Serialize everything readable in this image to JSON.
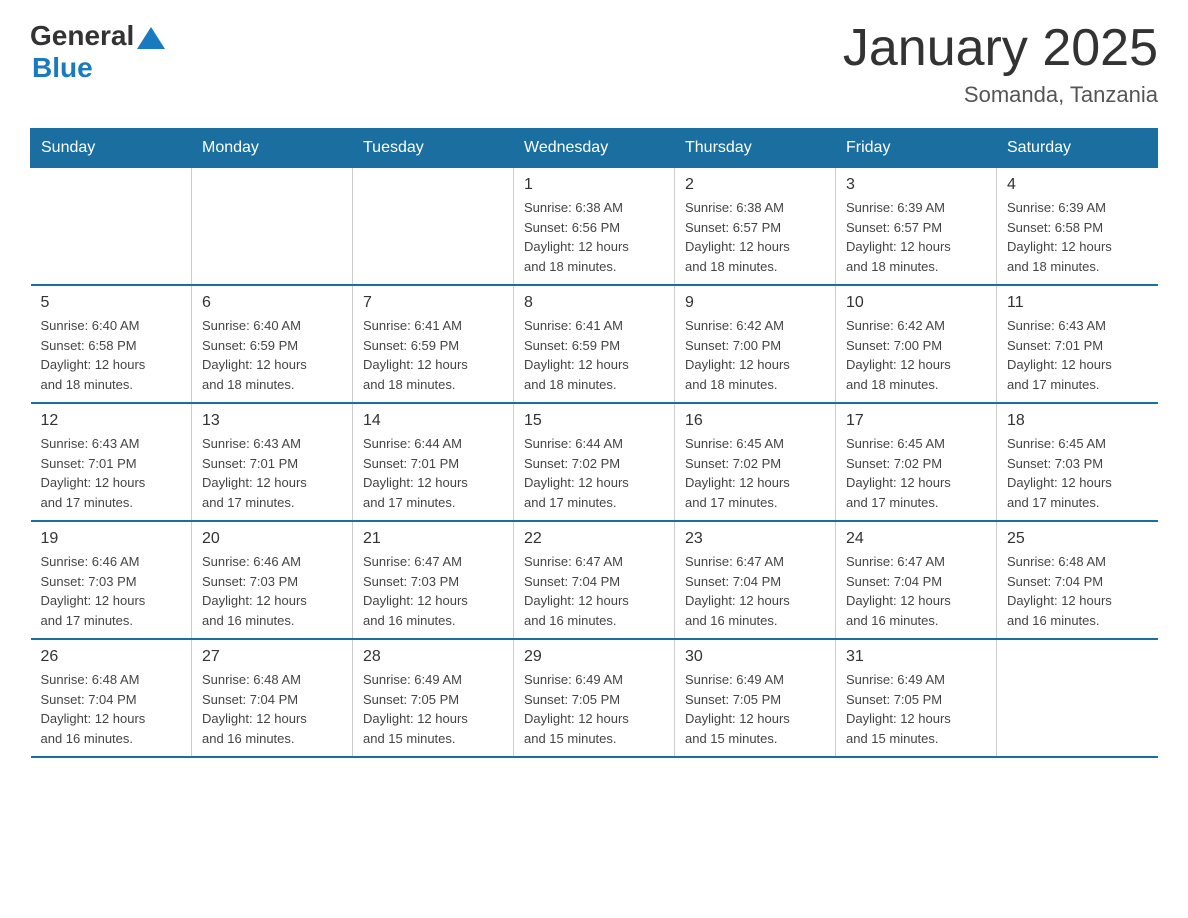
{
  "header": {
    "logo_general": "General",
    "logo_blue": "Blue",
    "title": "January 2025",
    "subtitle": "Somanda, Tanzania"
  },
  "days_of_week": [
    "Sunday",
    "Monday",
    "Tuesday",
    "Wednesday",
    "Thursday",
    "Friday",
    "Saturday"
  ],
  "weeks": [
    [
      {
        "day": "",
        "info": ""
      },
      {
        "day": "",
        "info": ""
      },
      {
        "day": "",
        "info": ""
      },
      {
        "day": "1",
        "info": "Sunrise: 6:38 AM\nSunset: 6:56 PM\nDaylight: 12 hours\nand 18 minutes."
      },
      {
        "day": "2",
        "info": "Sunrise: 6:38 AM\nSunset: 6:57 PM\nDaylight: 12 hours\nand 18 minutes."
      },
      {
        "day": "3",
        "info": "Sunrise: 6:39 AM\nSunset: 6:57 PM\nDaylight: 12 hours\nand 18 minutes."
      },
      {
        "day": "4",
        "info": "Sunrise: 6:39 AM\nSunset: 6:58 PM\nDaylight: 12 hours\nand 18 minutes."
      }
    ],
    [
      {
        "day": "5",
        "info": "Sunrise: 6:40 AM\nSunset: 6:58 PM\nDaylight: 12 hours\nand 18 minutes."
      },
      {
        "day": "6",
        "info": "Sunrise: 6:40 AM\nSunset: 6:59 PM\nDaylight: 12 hours\nand 18 minutes."
      },
      {
        "day": "7",
        "info": "Sunrise: 6:41 AM\nSunset: 6:59 PM\nDaylight: 12 hours\nand 18 minutes."
      },
      {
        "day": "8",
        "info": "Sunrise: 6:41 AM\nSunset: 6:59 PM\nDaylight: 12 hours\nand 18 minutes."
      },
      {
        "day": "9",
        "info": "Sunrise: 6:42 AM\nSunset: 7:00 PM\nDaylight: 12 hours\nand 18 minutes."
      },
      {
        "day": "10",
        "info": "Sunrise: 6:42 AM\nSunset: 7:00 PM\nDaylight: 12 hours\nand 18 minutes."
      },
      {
        "day": "11",
        "info": "Sunrise: 6:43 AM\nSunset: 7:01 PM\nDaylight: 12 hours\nand 17 minutes."
      }
    ],
    [
      {
        "day": "12",
        "info": "Sunrise: 6:43 AM\nSunset: 7:01 PM\nDaylight: 12 hours\nand 17 minutes."
      },
      {
        "day": "13",
        "info": "Sunrise: 6:43 AM\nSunset: 7:01 PM\nDaylight: 12 hours\nand 17 minutes."
      },
      {
        "day": "14",
        "info": "Sunrise: 6:44 AM\nSunset: 7:01 PM\nDaylight: 12 hours\nand 17 minutes."
      },
      {
        "day": "15",
        "info": "Sunrise: 6:44 AM\nSunset: 7:02 PM\nDaylight: 12 hours\nand 17 minutes."
      },
      {
        "day": "16",
        "info": "Sunrise: 6:45 AM\nSunset: 7:02 PM\nDaylight: 12 hours\nand 17 minutes."
      },
      {
        "day": "17",
        "info": "Sunrise: 6:45 AM\nSunset: 7:02 PM\nDaylight: 12 hours\nand 17 minutes."
      },
      {
        "day": "18",
        "info": "Sunrise: 6:45 AM\nSunset: 7:03 PM\nDaylight: 12 hours\nand 17 minutes."
      }
    ],
    [
      {
        "day": "19",
        "info": "Sunrise: 6:46 AM\nSunset: 7:03 PM\nDaylight: 12 hours\nand 17 minutes."
      },
      {
        "day": "20",
        "info": "Sunrise: 6:46 AM\nSunset: 7:03 PM\nDaylight: 12 hours\nand 16 minutes."
      },
      {
        "day": "21",
        "info": "Sunrise: 6:47 AM\nSunset: 7:03 PM\nDaylight: 12 hours\nand 16 minutes."
      },
      {
        "day": "22",
        "info": "Sunrise: 6:47 AM\nSunset: 7:04 PM\nDaylight: 12 hours\nand 16 minutes."
      },
      {
        "day": "23",
        "info": "Sunrise: 6:47 AM\nSunset: 7:04 PM\nDaylight: 12 hours\nand 16 minutes."
      },
      {
        "day": "24",
        "info": "Sunrise: 6:47 AM\nSunset: 7:04 PM\nDaylight: 12 hours\nand 16 minutes."
      },
      {
        "day": "25",
        "info": "Sunrise: 6:48 AM\nSunset: 7:04 PM\nDaylight: 12 hours\nand 16 minutes."
      }
    ],
    [
      {
        "day": "26",
        "info": "Sunrise: 6:48 AM\nSunset: 7:04 PM\nDaylight: 12 hours\nand 16 minutes."
      },
      {
        "day": "27",
        "info": "Sunrise: 6:48 AM\nSunset: 7:04 PM\nDaylight: 12 hours\nand 16 minutes."
      },
      {
        "day": "28",
        "info": "Sunrise: 6:49 AM\nSunset: 7:05 PM\nDaylight: 12 hours\nand 15 minutes."
      },
      {
        "day": "29",
        "info": "Sunrise: 6:49 AM\nSunset: 7:05 PM\nDaylight: 12 hours\nand 15 minutes."
      },
      {
        "day": "30",
        "info": "Sunrise: 6:49 AM\nSunset: 7:05 PM\nDaylight: 12 hours\nand 15 minutes."
      },
      {
        "day": "31",
        "info": "Sunrise: 6:49 AM\nSunset: 7:05 PM\nDaylight: 12 hours\nand 15 minutes."
      },
      {
        "day": "",
        "info": ""
      }
    ]
  ]
}
